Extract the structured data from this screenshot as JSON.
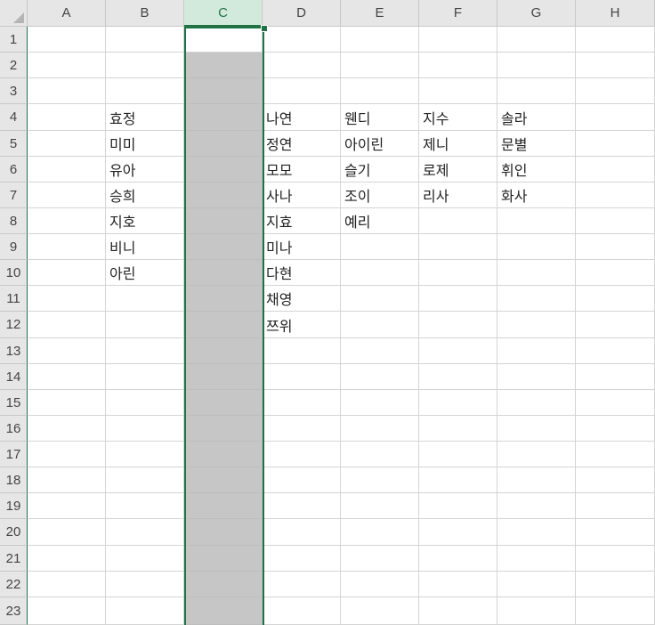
{
  "columns": [
    "A",
    "B",
    "C",
    "D",
    "E",
    "F",
    "G",
    "H"
  ],
  "selected_column": "C",
  "rows": [
    "1",
    "2",
    "3",
    "4",
    "5",
    "6",
    "7",
    "8",
    "9",
    "10",
    "11",
    "12",
    "13",
    "14",
    "15",
    "16",
    "17",
    "18",
    "19",
    "20",
    "21",
    "22",
    "23"
  ],
  "cells": {
    "B4": "효정",
    "B5": "미미",
    "B6": "유아",
    "B7": "승희",
    "B8": "지호",
    "B9": "비니",
    "B10": "아린",
    "D4": "나연",
    "D5": "정연",
    "D6": "모모",
    "D7": "사나",
    "D8": "지효",
    "D9": "미나",
    "D10": "다현",
    "D11": "채영",
    "D12": "쯔위",
    "E4": "웬디",
    "E5": "아이린",
    "E6": "슬기",
    "E7": "조이",
    "E8": "예리",
    "F4": "지수",
    "F5": "제니",
    "F6": "로제",
    "F7": "리사",
    "G4": "솔라",
    "G5": "문별",
    "G6": "휘인",
    "G7": "화사"
  },
  "colors": {
    "selection_accent": "#217346",
    "selected_header_bg": "#d2eadb",
    "selected_cells_bg": "#c6c6c6",
    "header_bg": "#e6e6e6",
    "gridline": "#d4d4d4"
  }
}
